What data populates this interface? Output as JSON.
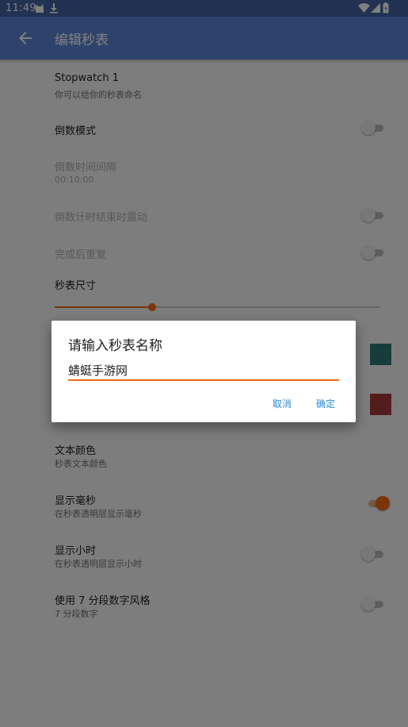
{
  "status_bar": {
    "time": "11:49",
    "icons": [
      "android-cat-icon",
      "download-icon",
      "wifi-icon",
      "cell-signal-icon",
      "battery-icon"
    ]
  },
  "app_bar": {
    "title": "编辑秒表",
    "back_icon": "arrow-left-icon"
  },
  "settings": {
    "name": {
      "title": "Stopwatch 1",
      "subtitle": "你可以给你的秒表命名"
    },
    "countdown_mode": {
      "title": "倒数模式",
      "on": false
    },
    "countdown_interval": {
      "title": "倒数时间间隔",
      "subtitle": "00:10:00"
    },
    "vibrate_on_end": {
      "title": "倒数计时结束时震动",
      "on": false
    },
    "repeat_after_done": {
      "title": "完成后重复",
      "on": false
    },
    "size": {
      "title": "秒表尺寸",
      "value_fraction": 0.3
    },
    "color_1": "#2f7a74",
    "color_2": "#a83a3a",
    "text_color": {
      "title": "文本颜色",
      "subtitle": "秒表文本颜色"
    },
    "show_millis": {
      "title": "显示毫秒",
      "subtitle": "在秒表透明层显示毫秒",
      "on": true
    },
    "show_hours": {
      "title": "显示小时",
      "subtitle": "在秒表透明层显示小时",
      "on": false
    },
    "seven_segment": {
      "title": "使用 7 分段数字风格",
      "subtitle": "7 分段数字",
      "on": false
    }
  },
  "dialog": {
    "title": "请输入秒表名称",
    "input_value": "蜻蜓手游网",
    "cancel_label": "取消",
    "ok_label": "确定"
  },
  "colors": {
    "status_bar": "#4364a5",
    "app_bar": "#5c86d8",
    "accent": "#f56b13",
    "dialog_button": "#2d8ad4"
  }
}
